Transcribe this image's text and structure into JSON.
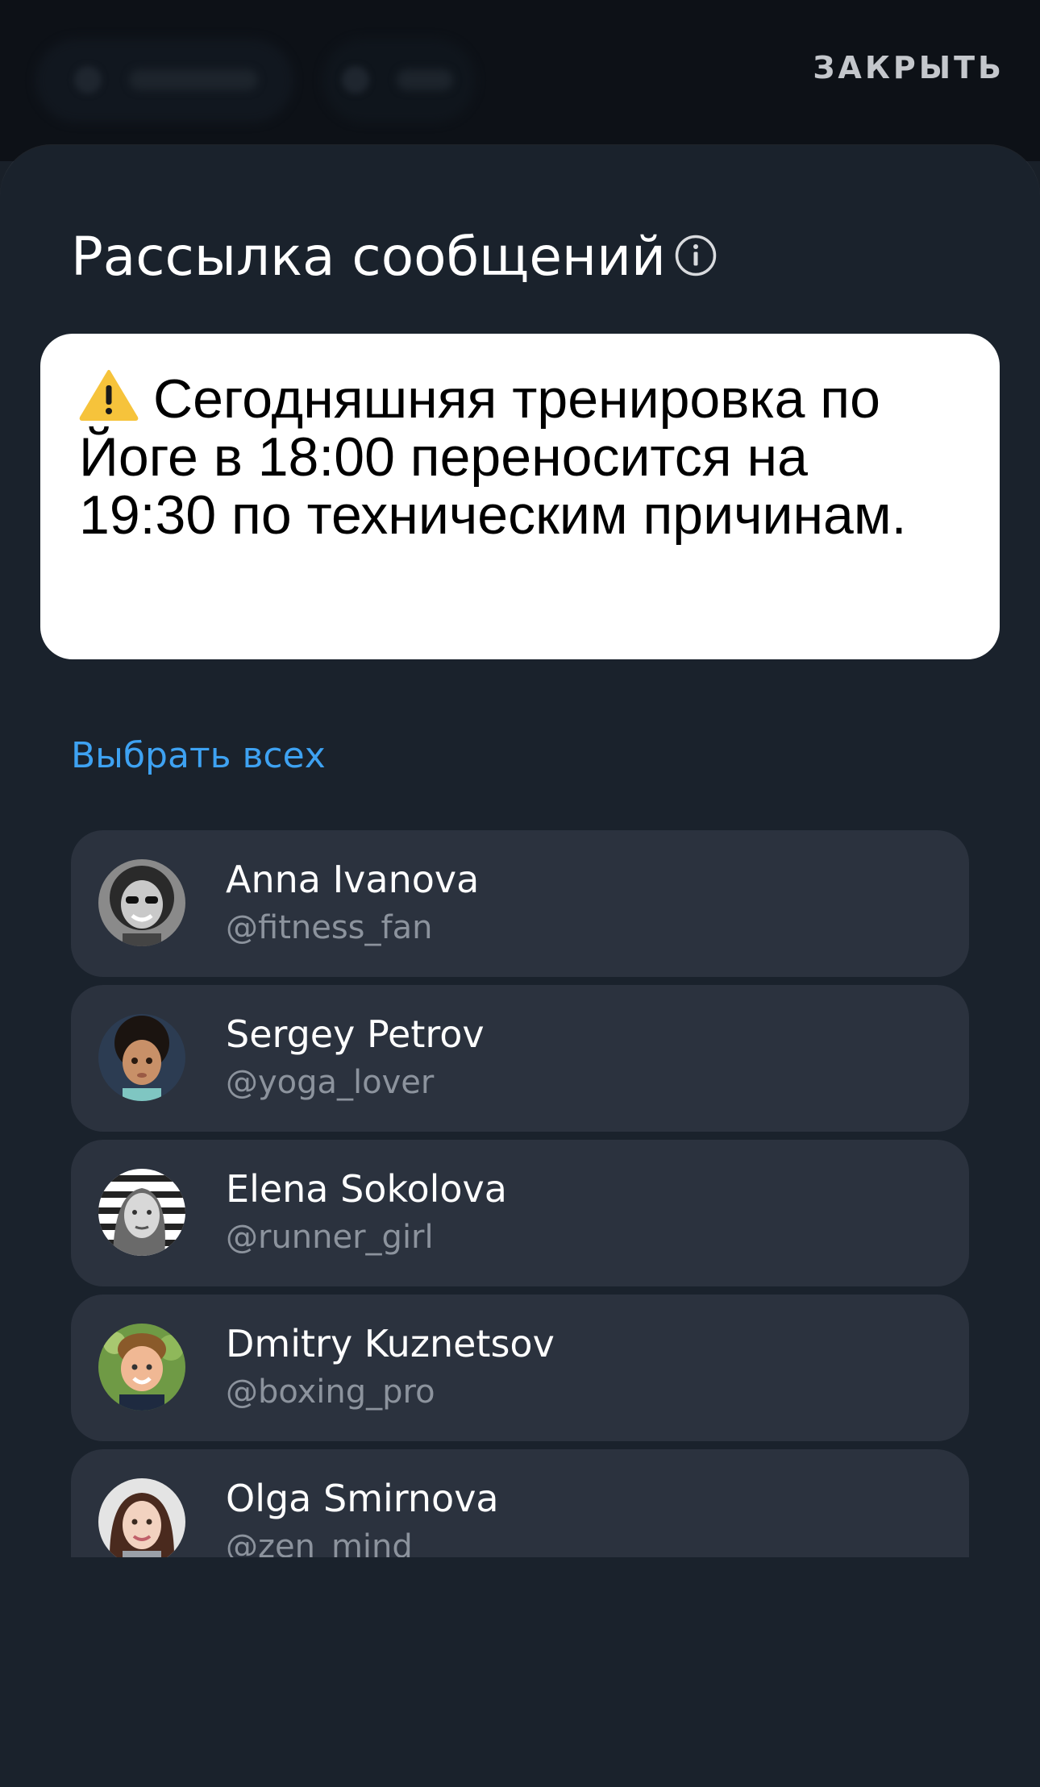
{
  "header": {
    "close_label": "ЗАКРЫТЬ"
  },
  "sheet": {
    "title": "Рассылка сообщений",
    "info_icon": "info-circle-icon"
  },
  "message": {
    "warning_icon": "warning-icon",
    "text": "Сегодняшняя тренировка по Йоге в 18:00 переносится на 19:30 по техническим причинам."
  },
  "select_all_label": "Выбрать всех",
  "colors": {
    "accent": "#3ea2f2",
    "sheet_bg": "#1a222c",
    "card_bg": "#2b323e",
    "handle_text": "#8c939d"
  },
  "recipients": [
    {
      "name": "Anna Ivanova",
      "handle": "@fitness_fan"
    },
    {
      "name": "Sergey Petrov",
      "handle": "@yoga_lover"
    },
    {
      "name": "Elena Sokolova",
      "handle": "@runner_girl"
    },
    {
      "name": "Dmitry Kuznetsov",
      "handle": "@boxing_pro"
    },
    {
      "name": "Olga Smirnova",
      "handle": "@zen_mind"
    }
  ]
}
